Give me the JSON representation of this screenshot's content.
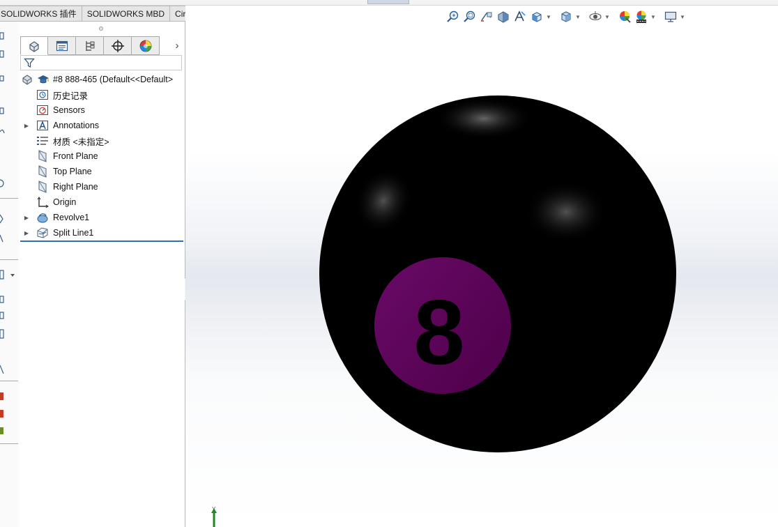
{
  "command_tabs": [
    "SOLIDWORKS 插件",
    "SOLIDWORKS MBD",
    "CircuitWorks"
  ],
  "feature_manager": {
    "panel_tabs": [
      "feature-manager-icon",
      "property-manager-icon",
      "configuration-manager-icon",
      "dimxpert-manager-icon",
      "display-manager-icon"
    ],
    "more_tabs_glyph": "›",
    "filter_icon": "funnel-icon",
    "tree": {
      "root": "#8 888-465  (Default<<Default>",
      "items": [
        {
          "label": "历史记录",
          "icon": "history-icon",
          "expandable": false
        },
        {
          "label": "Sensors",
          "icon": "sensors-icon",
          "expandable": false
        },
        {
          "label": "Annotations",
          "icon": "annotations-icon",
          "expandable": true
        },
        {
          "label": "材质 <未指定>",
          "icon": "material-icon",
          "expandable": false
        },
        {
          "label": "Front Plane",
          "icon": "plane-icon",
          "expandable": false
        },
        {
          "label": "Top Plane",
          "icon": "plane-icon",
          "expandable": false
        },
        {
          "label": "Right Plane",
          "icon": "plane-icon",
          "expandable": false
        },
        {
          "label": "Origin",
          "icon": "origin-icon",
          "expandable": false
        },
        {
          "label": "Revolve1",
          "icon": "revolve-icon",
          "expandable": true
        },
        {
          "label": "Split Line1",
          "icon": "split-line-icon",
          "expandable": true
        }
      ]
    }
  },
  "viewport": {
    "hud_icons": [
      "zoom-to-fit-icon",
      "zoom-to-area-icon",
      "previous-view-icon",
      "section-view-icon",
      "dynamic-annotation-icon",
      "view-orientation-icon",
      "display-style-icon",
      "hide-show-items-icon",
      "edit-appearance-icon",
      "apply-scene-icon",
      "view-settings-icon"
    ],
    "model": {
      "ball_label": "8",
      "colors": {
        "ball": "#000000",
        "circle": "#5a005a",
        "number": "#000000",
        "highlight": "#6a6a6a"
      }
    },
    "triad_axis_label": "Y"
  }
}
